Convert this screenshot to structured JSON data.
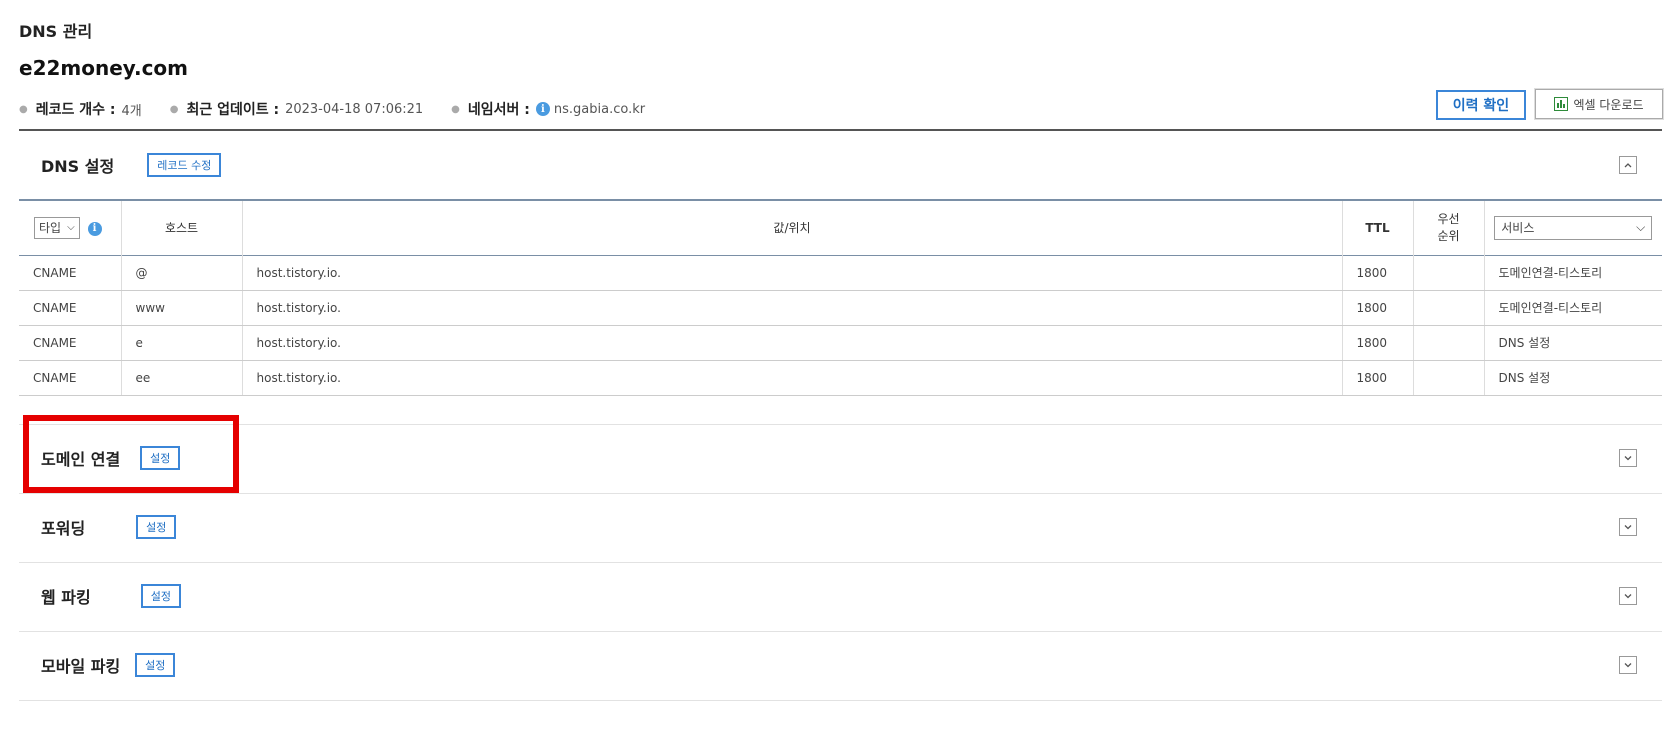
{
  "page": {
    "label": "DNS 관리",
    "domain": "e22money.com"
  },
  "meta": {
    "record_count_label": "레코드 개수 :",
    "record_count_value": "4개",
    "last_update_label": "최근 업데이트 :",
    "last_update_value": "2023-04-18 07:06:21",
    "nameserver_label": "네임서버 :",
    "nameserver_value": "ns.gabia.co.kr"
  },
  "actions": {
    "history": "이력 확인",
    "excel": "엑셀 다운로드"
  },
  "dns_section": {
    "title": "DNS 설정",
    "edit_label": "레코드 수정",
    "columns": {
      "type": "타입",
      "host": "호스트",
      "value": "값/위치",
      "ttl": "TTL",
      "priority": "우선 순위",
      "service": "서비스"
    },
    "rows": [
      {
        "type": "CNAME",
        "host": "@",
        "value": "host.tistory.io.",
        "ttl": "1800",
        "priority": "",
        "service": "도메인연결-티스토리"
      },
      {
        "type": "CNAME",
        "host": "www",
        "value": "host.tistory.io.",
        "ttl": "1800",
        "priority": "",
        "service": "도메인연결-티스토리"
      },
      {
        "type": "CNAME",
        "host": "e",
        "value": "host.tistory.io.",
        "ttl": "1800",
        "priority": "",
        "service": "DNS 설정"
      },
      {
        "type": "CNAME",
        "host": "ee",
        "value": "host.tistory.io.",
        "ttl": "1800",
        "priority": "",
        "service": "DNS 설정"
      }
    ]
  },
  "sections": [
    {
      "title": "도메인 연결",
      "button": "설정"
    },
    {
      "title": "포워딩",
      "button": "설정"
    },
    {
      "title": "웹 파킹",
      "button": "설정"
    },
    {
      "title": "모바일 파킹",
      "button": "설정"
    }
  ],
  "colors": {
    "accent": "#3b86d8",
    "highlight": "#e50000",
    "excel_icon": "#2e8b3a"
  }
}
